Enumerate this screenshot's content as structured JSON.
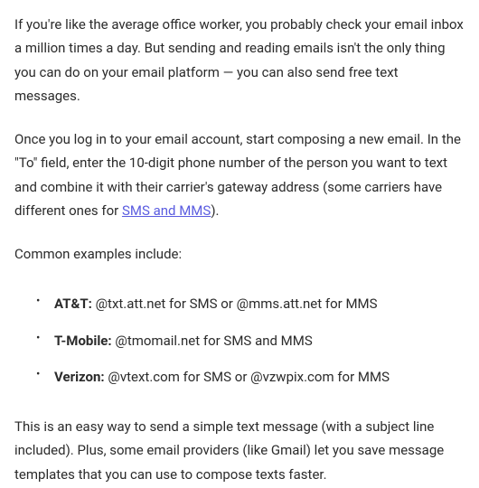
{
  "intro": "If you're like the average office worker, you probably check your email inbox a million times a day. But sending and reading emails isn't the only thing you can do on your email platform — you can also send free text messages.",
  "howto_pre": "Once you log in to your email account, start composing a new email. In the \"To\" field, enter the 10-digit phone number of the person you want to text and combine it with their carrier's gateway address (some carriers have different ones for ",
  "howto_link": "SMS and MMS",
  "howto_post": ").",
  "lead": "Common examples include:",
  "items": [
    {
      "label": "AT&T:",
      "detail": " @txt.att.net for SMS or @mms.att.net for MMS"
    },
    {
      "label": "T-Mobile:",
      "detail": " @tmomail.net for SMS and MMS"
    },
    {
      "label": "Verizon:",
      "detail": " @vtext.com for SMS or @vzwpix.com for MMS"
    }
  ],
  "outro": "This is an easy way to send a simple text message (with a subject line included). Plus, some email providers (like Gmail) let you save message templates that you can use to compose texts faster."
}
